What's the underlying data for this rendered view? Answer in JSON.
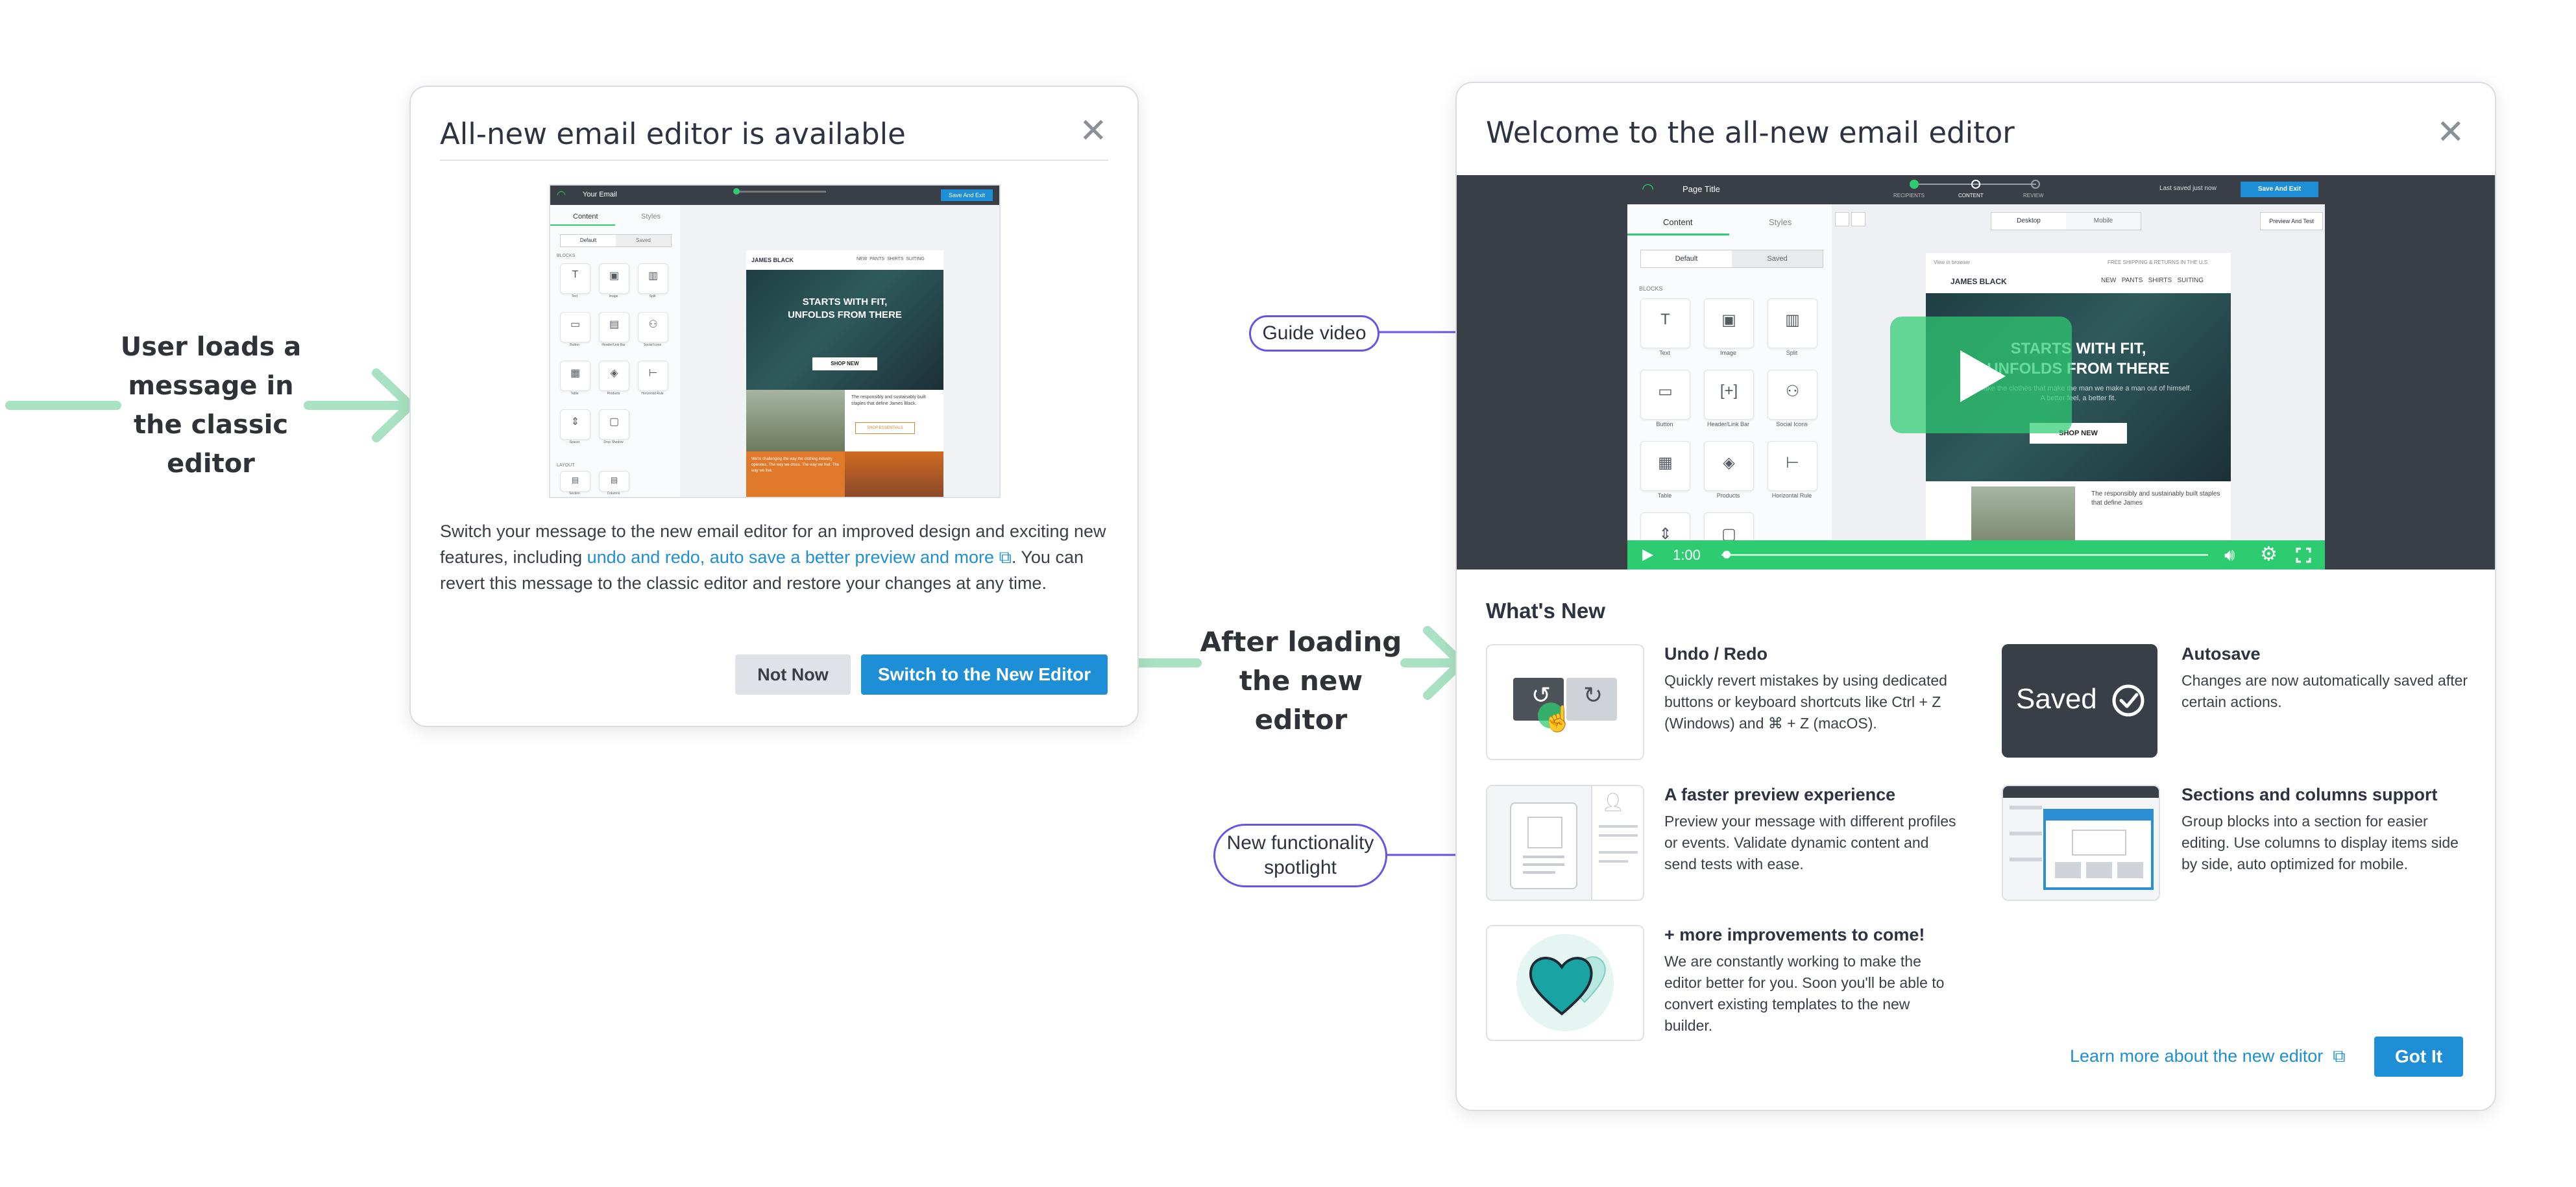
{
  "labels": {
    "user_loads": "User loads a message in the classic editor",
    "after_loading": "After loading the new editor",
    "guide_video": "Guide video",
    "new_functionality": "New functionality spotlight"
  },
  "classic_modal": {
    "title": "All-new email editor is available",
    "body_start": "Switch your message to the new email editor for an improved design and exciting new features, including ",
    "body_link": "undo and redo, auto save a better preview and more",
    "body_end": ". You can revert this message to the classic editor and restore your changes at any time.",
    "not_now": "Not Now",
    "switch": "Switch to the New Editor"
  },
  "new_modal": {
    "title": "Welcome to the all-new email editor",
    "whats_new": "What's New",
    "learn_more": "Learn more about the new editor",
    "got_it": "Got It",
    "features": [
      {
        "title": "Undo / Redo",
        "desc": "Quickly revert mistakes by using dedicated buttons or keyboard shortcuts like Ctrl + Z (Windows) and ⌘ + Z (macOS)."
      },
      {
        "title": "Autosave",
        "desc": "Changes are now automatically saved after certain actions."
      },
      {
        "title": "A faster preview experience",
        "desc": "Preview your message with different profiles or events. Validate dynamic content and send tests with ease."
      },
      {
        "title": "Sections and columns support",
        "desc": "Group blocks into a section for easier editing. Use columns to display items side by side, auto optimized for mobile."
      },
      {
        "title": "+ more improvements to come!",
        "desc": "We are constantly working to make the editor better for you. Soon you'll be able to convert existing templates to the new builder."
      }
    ],
    "autosave_thumb": "Saved"
  },
  "video": {
    "time": "1:00",
    "progress": 0.01,
    "page_title": "Page Title",
    "steps": [
      "RECIPIENTS",
      "CONTENT",
      "REVIEW"
    ],
    "last_saved": "Last saved just now",
    "save_exit": "Save And Exit",
    "tab_content": "Content",
    "tab_styles": "Styles",
    "seg_default": "Default",
    "seg_saved": "Saved",
    "blocks_label": "BLOCKS",
    "blocks": [
      "Text",
      "Image",
      "Split",
      "Button",
      "Header/Link Bar",
      "Social Icons",
      "Table",
      "Products",
      "Horizontal Rule"
    ],
    "desktop": "Desktop",
    "mobile": "Mobile",
    "preview_test": "Preview And Test",
    "view_browser": "View in browser",
    "shipping": "FREE SHIPPING & RETURNS IN THE U.S.",
    "brand": "JAMES BLACK",
    "nav": [
      "NEW",
      "PANTS",
      "SHIRTS",
      "SUITING"
    ],
    "hero_line1": "STARTS WITH FIT,",
    "hero_line2": "UNFOLDS FROM THERE",
    "hero_sub": "We make the clothes that make the man we make a man out of himself. A better feel, a better fit.",
    "shop_new": "SHOP NEW",
    "bottom_text": "The responsibly and sustainably built staples that define James"
  },
  "classic_thumb": {
    "your_email": "Your Email",
    "save_exit": "Save And Exit",
    "tab_content": "Content",
    "tab_styles": "Styles",
    "seg_default": "Default",
    "seg_saved": "Saved",
    "blocks_label": "BLOCKS",
    "layout_label": "LAYOUT",
    "blocks": [
      "Text",
      "Image",
      "Split",
      "Button",
      "Header/Link Bar",
      "Social Icons",
      "Table",
      "Products",
      "Horizontal Rule",
      "Spacer",
      "Drop Shadow"
    ],
    "layout_blocks": [
      "Section",
      "Columns"
    ],
    "brand": "JAMES BLACK",
    "nav": [
      "NEW",
      "PANTS",
      "SHIRTS",
      "SUITING"
    ],
    "hero_line1": "STARTS WITH FIT,",
    "hero_line2": "UNFOLDS FROM THERE",
    "shop_new": "SHOP NEW",
    "side_text": "The responsibly and sustainably built staples that define James Black.",
    "shop_essentials": "SHOP ESSENTIALS",
    "orange_text": "We're challenging the way the clothing industry operates. The way we dress. The way we feel. The way we live."
  },
  "colors": {
    "arrow_green": "#a8e2c2",
    "callout_purple": "#6b52e0",
    "primary_blue": "#1e8fd6",
    "video_green": "#2ecc71",
    "editor_dark": "#3a3f47"
  }
}
